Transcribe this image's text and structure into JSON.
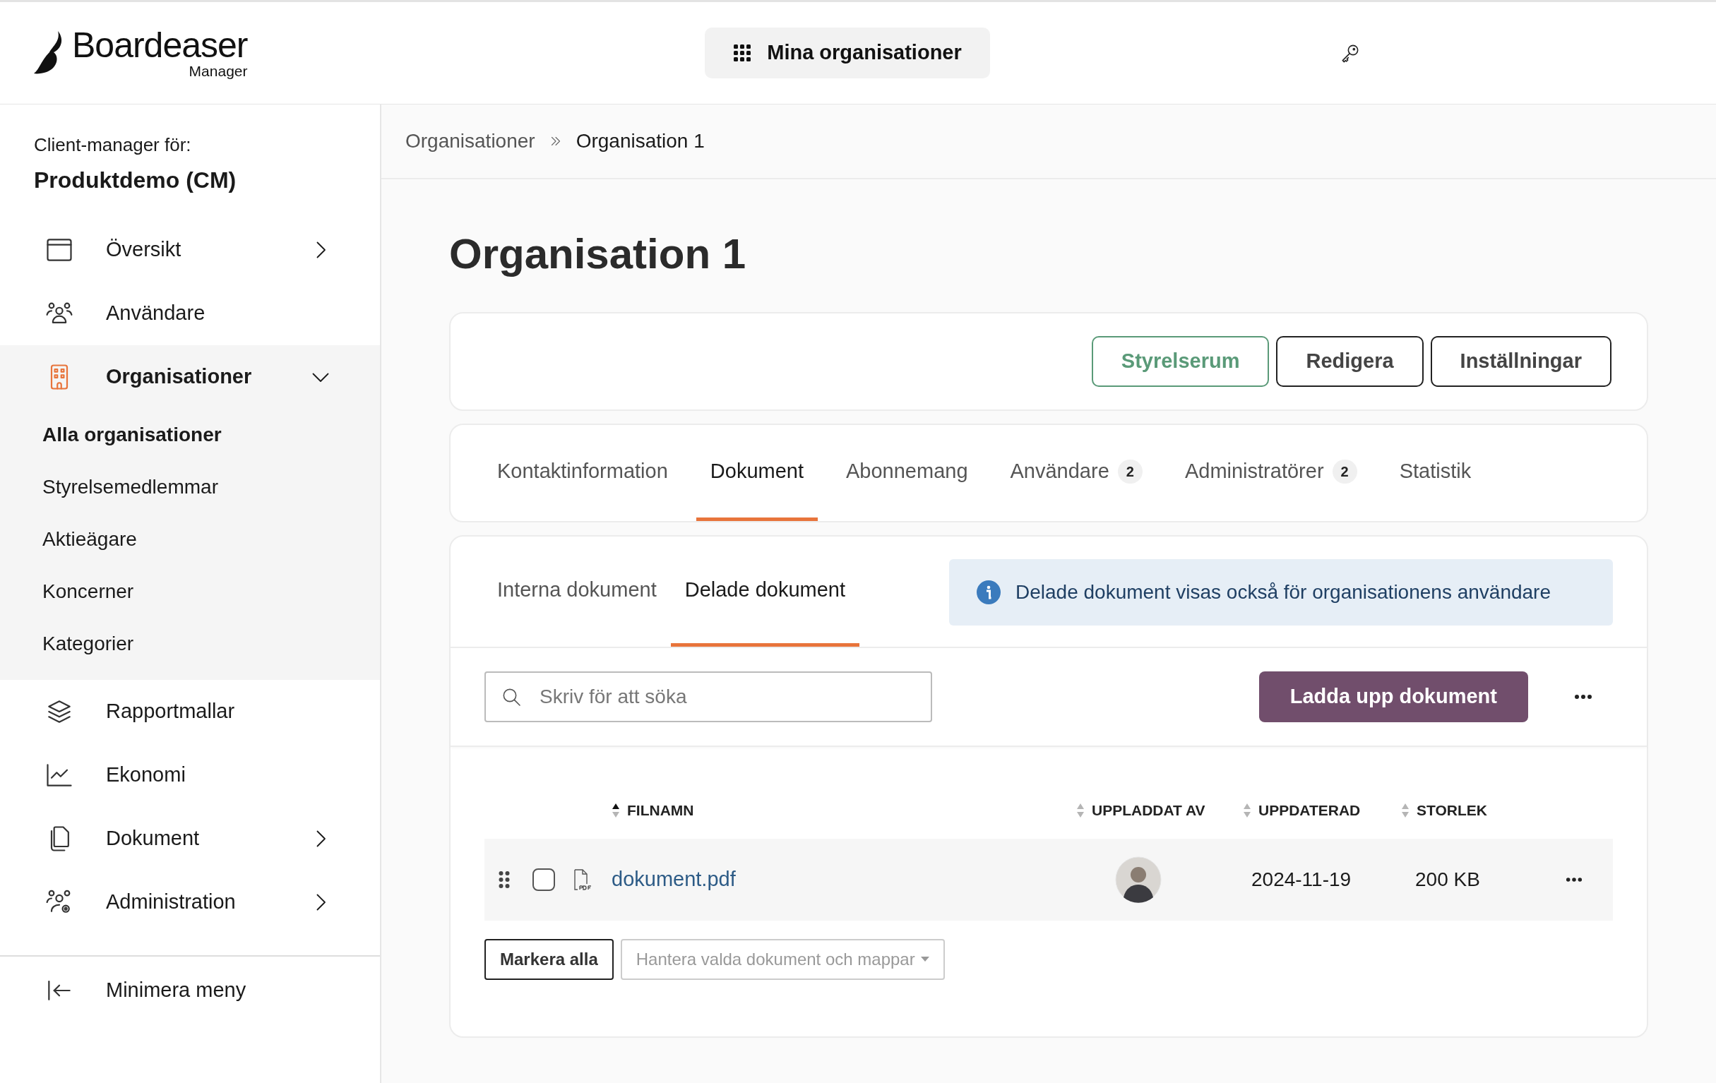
{
  "header": {
    "logo_text": "Boardeaser",
    "logo_subtext": "Manager",
    "org_button": "Mina organisationer"
  },
  "sidebar": {
    "context_label": "Client-manager för:",
    "context_name": "Produktdemo (CM)",
    "items": [
      {
        "label": "Översikt",
        "expanded": false
      },
      {
        "label": "Användare"
      },
      {
        "label": "Organisationer",
        "expanded": true,
        "children": [
          {
            "label": "Alla organisationer",
            "selected": true
          },
          {
            "label": "Styrelsemedlemmar",
            "selected": false
          },
          {
            "label": "Aktieägare",
            "selected": false
          },
          {
            "label": "Koncerner",
            "selected": false
          },
          {
            "label": "Kategorier",
            "selected": false
          }
        ]
      },
      {
        "label": "Rapportmallar"
      },
      {
        "label": "Ekonomi"
      },
      {
        "label": "Dokument",
        "expanded": false
      },
      {
        "label": "Administration",
        "expanded": false
      }
    ],
    "collapse": "Minimera meny"
  },
  "breadcrumb": [
    "Organisationer",
    "Organisation 1"
  ],
  "title": "Organisation 1",
  "actions": [
    {
      "label": "Styrelserum",
      "kind": "accent"
    },
    {
      "label": "Redigera",
      "kind": "outline"
    },
    {
      "label": "Inställningar",
      "kind": "outline"
    }
  ],
  "tabs": [
    {
      "label": "Kontaktinformation",
      "selected": false
    },
    {
      "label": "Dokument",
      "selected": true
    },
    {
      "label": "Abonnemang",
      "selected": false
    },
    {
      "label": "Användare",
      "count": "2",
      "selected": false
    },
    {
      "label": "Administratörer",
      "count": "2",
      "selected": false
    },
    {
      "label": "Statistik",
      "selected": false
    }
  ],
  "subtabs": [
    {
      "label": "Interna dokument",
      "selected": false
    },
    {
      "label": "Delade dokument",
      "selected": true
    }
  ],
  "info": "Delade dokument visas också för organisationens användare",
  "search": {
    "placeholder": "Skriv för att söka"
  },
  "upload_button": "Ladda upp dokument",
  "table": {
    "columns": [
      {
        "label": "FILNAMN",
        "sorted": true
      },
      {
        "label": "UPPLADDAT AV",
        "sorted": false
      },
      {
        "label": "UPPDATERAD",
        "sorted": false
      },
      {
        "label": "STORLEK",
        "sorted": false
      }
    ],
    "rows": [
      {
        "filename": "dokument.pdf",
        "checked": false,
        "updated": "2024-11-19",
        "size": "200 KB"
      }
    ]
  },
  "footer_buttons": [
    {
      "label": "Markera alla",
      "disabled": false
    },
    {
      "label": "Hantera valda dokument och mappar",
      "disabled": true
    }
  ]
}
